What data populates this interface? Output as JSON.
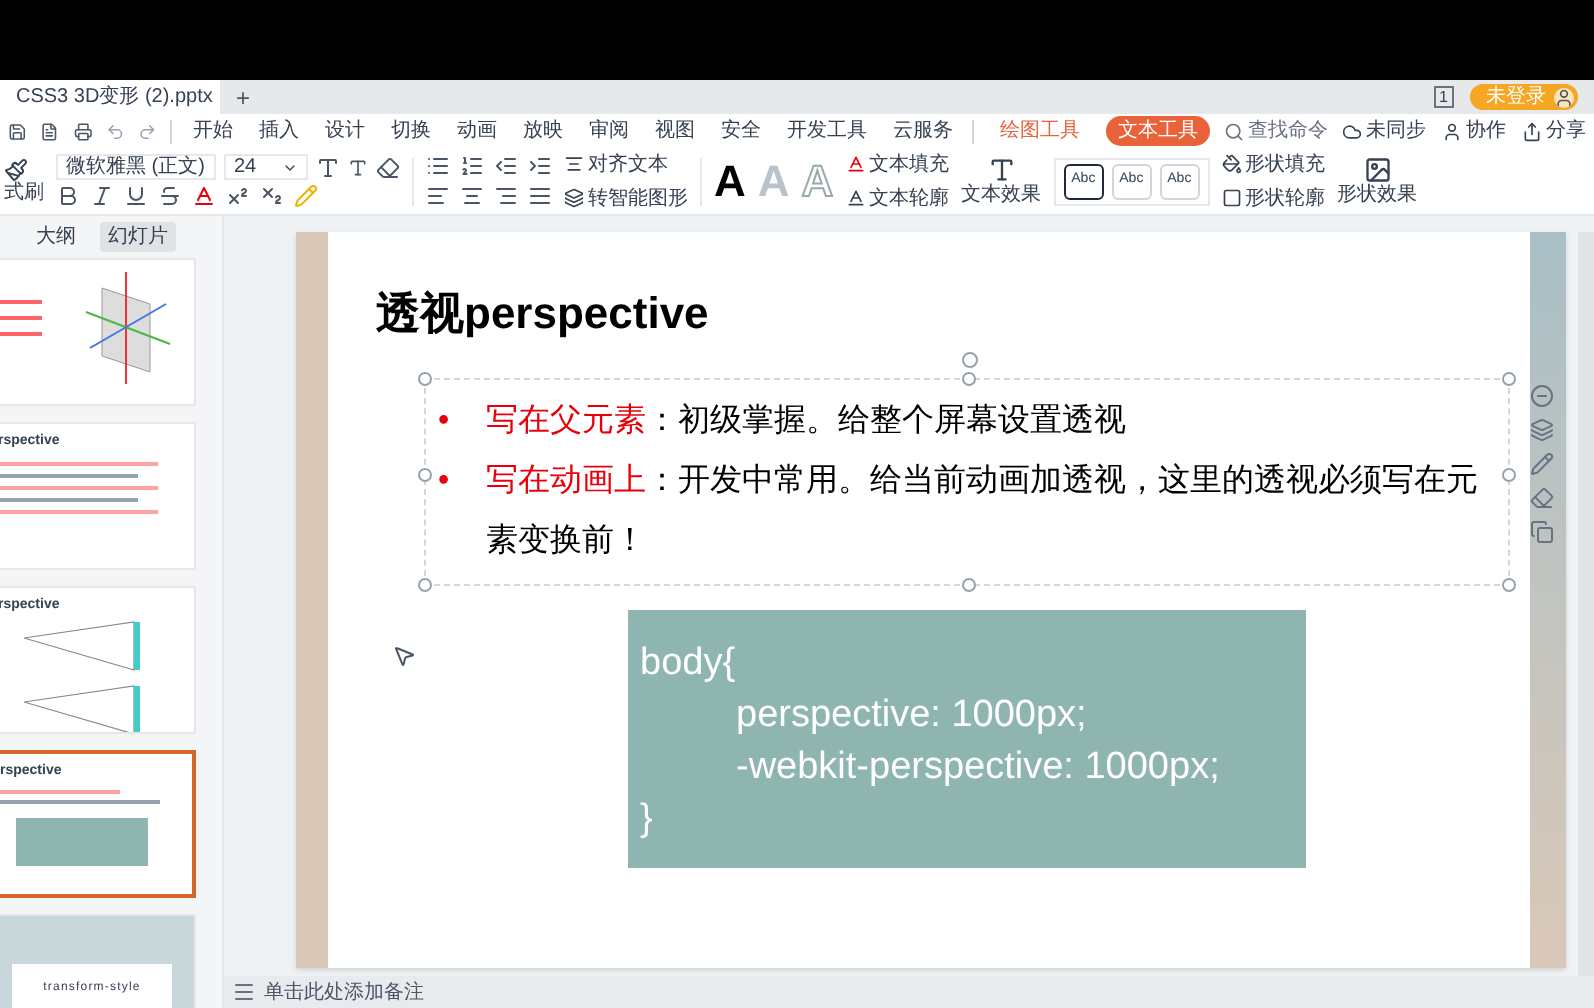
{
  "window": {
    "file_tab": "CSS3 3D变形 (2).pptx",
    "new_tab": "+",
    "window_count": "1",
    "account": "未登录"
  },
  "menu": {
    "items": [
      {
        "label": "开始",
        "selected": false
      },
      {
        "label": "插入",
        "selected": false
      },
      {
        "label": "设计",
        "selected": false
      },
      {
        "label": "切换",
        "selected": false
      },
      {
        "label": "动画",
        "selected": false
      },
      {
        "label": "放映",
        "selected": false
      },
      {
        "label": "审阅",
        "selected": false
      },
      {
        "label": "视图",
        "selected": false
      },
      {
        "label": "安全",
        "selected": false
      },
      {
        "label": "开发工具",
        "selected": false
      },
      {
        "label": "云服务",
        "selected": false
      }
    ],
    "context_tabs": [
      {
        "label": "绘图工具",
        "selected": false
      },
      {
        "label": "文本工具",
        "selected": true
      }
    ],
    "search_placeholder": "查找命令",
    "actions": [
      "未同步",
      "协作",
      "分享"
    ]
  },
  "ribbon": {
    "format_painter": "式刷",
    "font": "微软雅黑 (正文)",
    "size": "24",
    "align_text": "对齐文本",
    "smart_art": "转智能图形",
    "wordart": [
      {
        "label": "A",
        "kind": "solid"
      },
      {
        "label": "A",
        "kind": "light"
      },
      {
        "label": "A",
        "kind": "outline"
      }
    ],
    "text_fill": "文本填充",
    "text_outline": "文本轮廓",
    "text_effect": "文本效果",
    "style_samples": [
      {
        "label": "Abc",
        "selected": true
      },
      {
        "label": "Abc",
        "selected": false
      },
      {
        "label": "Abc",
        "selected": false
      }
    ],
    "shape_fill": "形状填充",
    "shape_outline": "形状轮廓",
    "shape_effect": "形状效果"
  },
  "sidebar": {
    "tabs": [
      {
        "label": "大纲",
        "selected": false
      },
      {
        "label": "幻灯片",
        "selected": true
      }
    ],
    "slides": [
      {
        "kind": "axes",
        "selected": false
      },
      {
        "kind": "text",
        "title": "rspective",
        "selected": false
      },
      {
        "kind": "diagram",
        "title": "rspective",
        "selected": false
      },
      {
        "kind": "code",
        "title": "rspective",
        "selected": true
      },
      {
        "kind": "cover",
        "title": "transform-style",
        "selected": false
      }
    ]
  },
  "slide": {
    "title": "透视perspective",
    "bullets": [
      {
        "mark": "•",
        "term": "写在父元素",
        "text": "：初级掌握。给整个屏幕设置透视"
      },
      {
        "mark": "•",
        "term": "写在动画上",
        "text": "：开发中常用。给当前动画加透视，这里的透视必须写在元素变换前！"
      }
    ],
    "code": {
      "open": "body{",
      "declarations": [
        "perspective: 1000px;",
        "-webkit-perspective: 1000px;"
      ],
      "close": "}"
    }
  },
  "status_bar": {
    "notes_placeholder": "单击此处添加备注"
  }
}
